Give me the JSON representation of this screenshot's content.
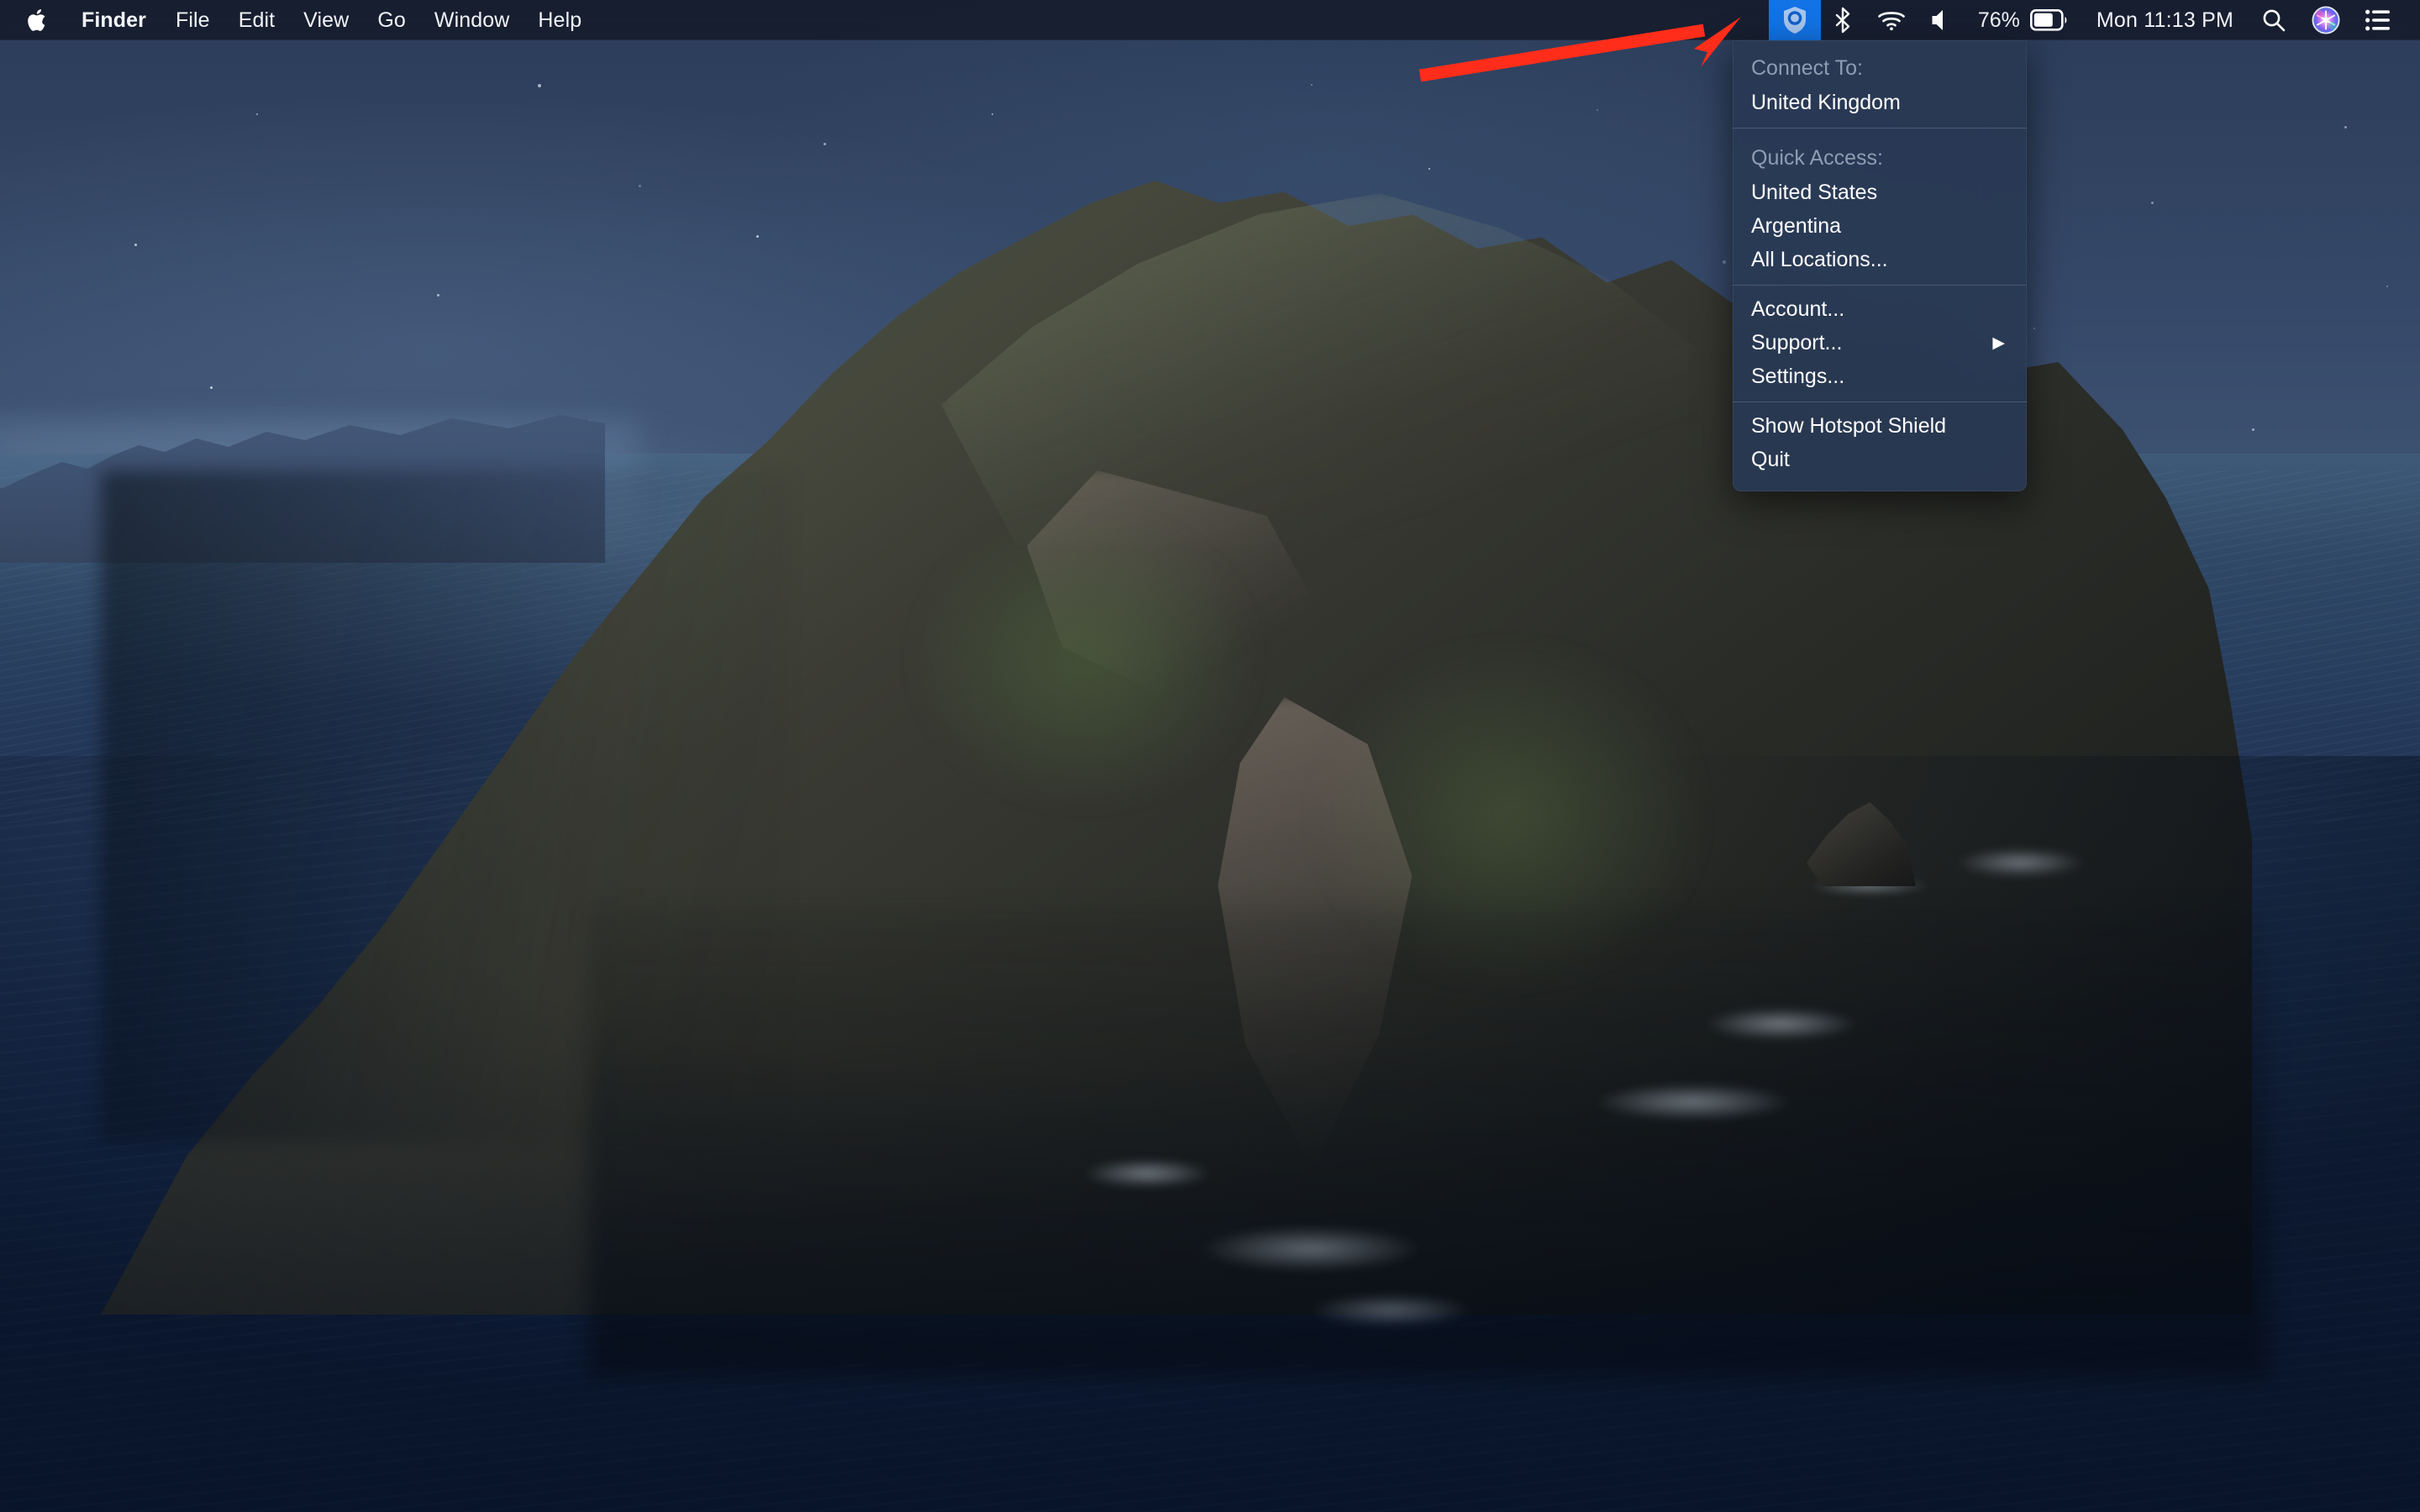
{
  "menubar": {
    "apple_logo": "apple-logo",
    "app_menus": [
      {
        "label": "Finder",
        "bold": true
      },
      {
        "label": "File",
        "bold": false
      },
      {
        "label": "Edit",
        "bold": false
      },
      {
        "label": "View",
        "bold": false
      },
      {
        "label": "Go",
        "bold": false
      },
      {
        "label": "Window",
        "bold": false
      },
      {
        "label": "Help",
        "bold": false
      }
    ],
    "status": {
      "hotspot_shield_icon": "shield-icon",
      "hotspot_shield_highlight_color": "#1273e6",
      "bluetooth_icon": "bluetooth-icon",
      "wifi_icon": "wifi-icon",
      "volume_icon": "volume-icon",
      "battery_percent": "76%",
      "battery_icon": "battery-icon",
      "clock": "Mon 11:13 PM",
      "spotlight_icon": "search-icon",
      "siri_icon": "siri-icon",
      "control_center_icon": "control-center-icon"
    }
  },
  "vpn_menu": {
    "sections": [
      {
        "header": "Connect To:",
        "items": [
          {
            "label": "United Kingdom",
            "submenu": false
          }
        ]
      },
      {
        "header": "Quick Access:",
        "items": [
          {
            "label": "United States",
            "submenu": false
          },
          {
            "label": "Argentina",
            "submenu": false
          },
          {
            "label": "All Locations...",
            "submenu": false
          }
        ]
      },
      {
        "header": null,
        "items": [
          {
            "label": "Account...",
            "submenu": false
          },
          {
            "label": "Support...",
            "submenu": true
          },
          {
            "label": "Settings...",
            "submenu": false
          }
        ]
      },
      {
        "header": null,
        "items": [
          {
            "label": "Show Hotspot Shield",
            "submenu": false
          },
          {
            "label": "Quit",
            "submenu": false
          }
        ]
      }
    ],
    "submenu_arrow_glyph": "▶"
  },
  "annotation": {
    "type": "arrow",
    "color": "#FF2D1A",
    "points_to": "hotspot-shield-menu-bar-icon"
  },
  "desktop": {
    "wallpaper_name": "catalina-night-island",
    "sky_color": "#36496a",
    "ocean_color": "#1c3050",
    "island_color": "#33342e"
  }
}
